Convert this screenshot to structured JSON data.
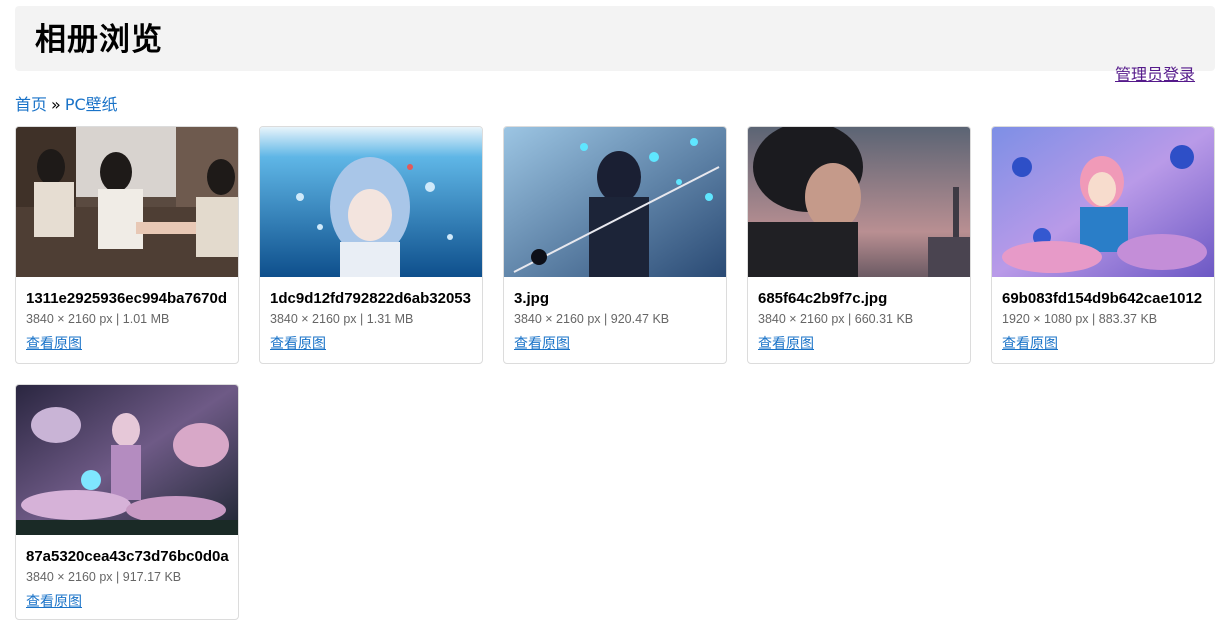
{
  "header": {
    "title": "相册浏览"
  },
  "admin_login": "管理员登录",
  "breadcrumb": {
    "home": "首页",
    "separator": "»",
    "current": "PC壁纸"
  },
  "photos": [
    {
      "filename": "1311e2925936ec994ba7670d",
      "dimensions": "3840 × 2160 px",
      "size": "1.01 MB",
      "link_label": "查看原图"
    },
    {
      "filename": "1dc9d12fd792822d6ab32053",
      "dimensions": "3840 × 2160 px",
      "size": "1.31 MB",
      "link_label": "查看原图"
    },
    {
      "filename": "3.jpg",
      "dimensions": "3840 × 2160 px",
      "size": "920.47 KB",
      "link_label": "查看原图"
    },
    {
      "filename": "685f64c2b9f7c.jpg",
      "dimensions": "3840 × 2160 px",
      "size": "660.31 KB",
      "link_label": "查看原图"
    },
    {
      "filename": "69b083fd154d9b642cae1012",
      "dimensions": "1920 × 1080 px",
      "size": "883.37 KB",
      "link_label": "查看原图"
    },
    {
      "filename": "87a5320cea43c73d76bc0d0a",
      "dimensions": "3840 × 2160 px",
      "size": "917.17 KB",
      "link_label": "查看原图"
    }
  ],
  "meta_separator": "|"
}
